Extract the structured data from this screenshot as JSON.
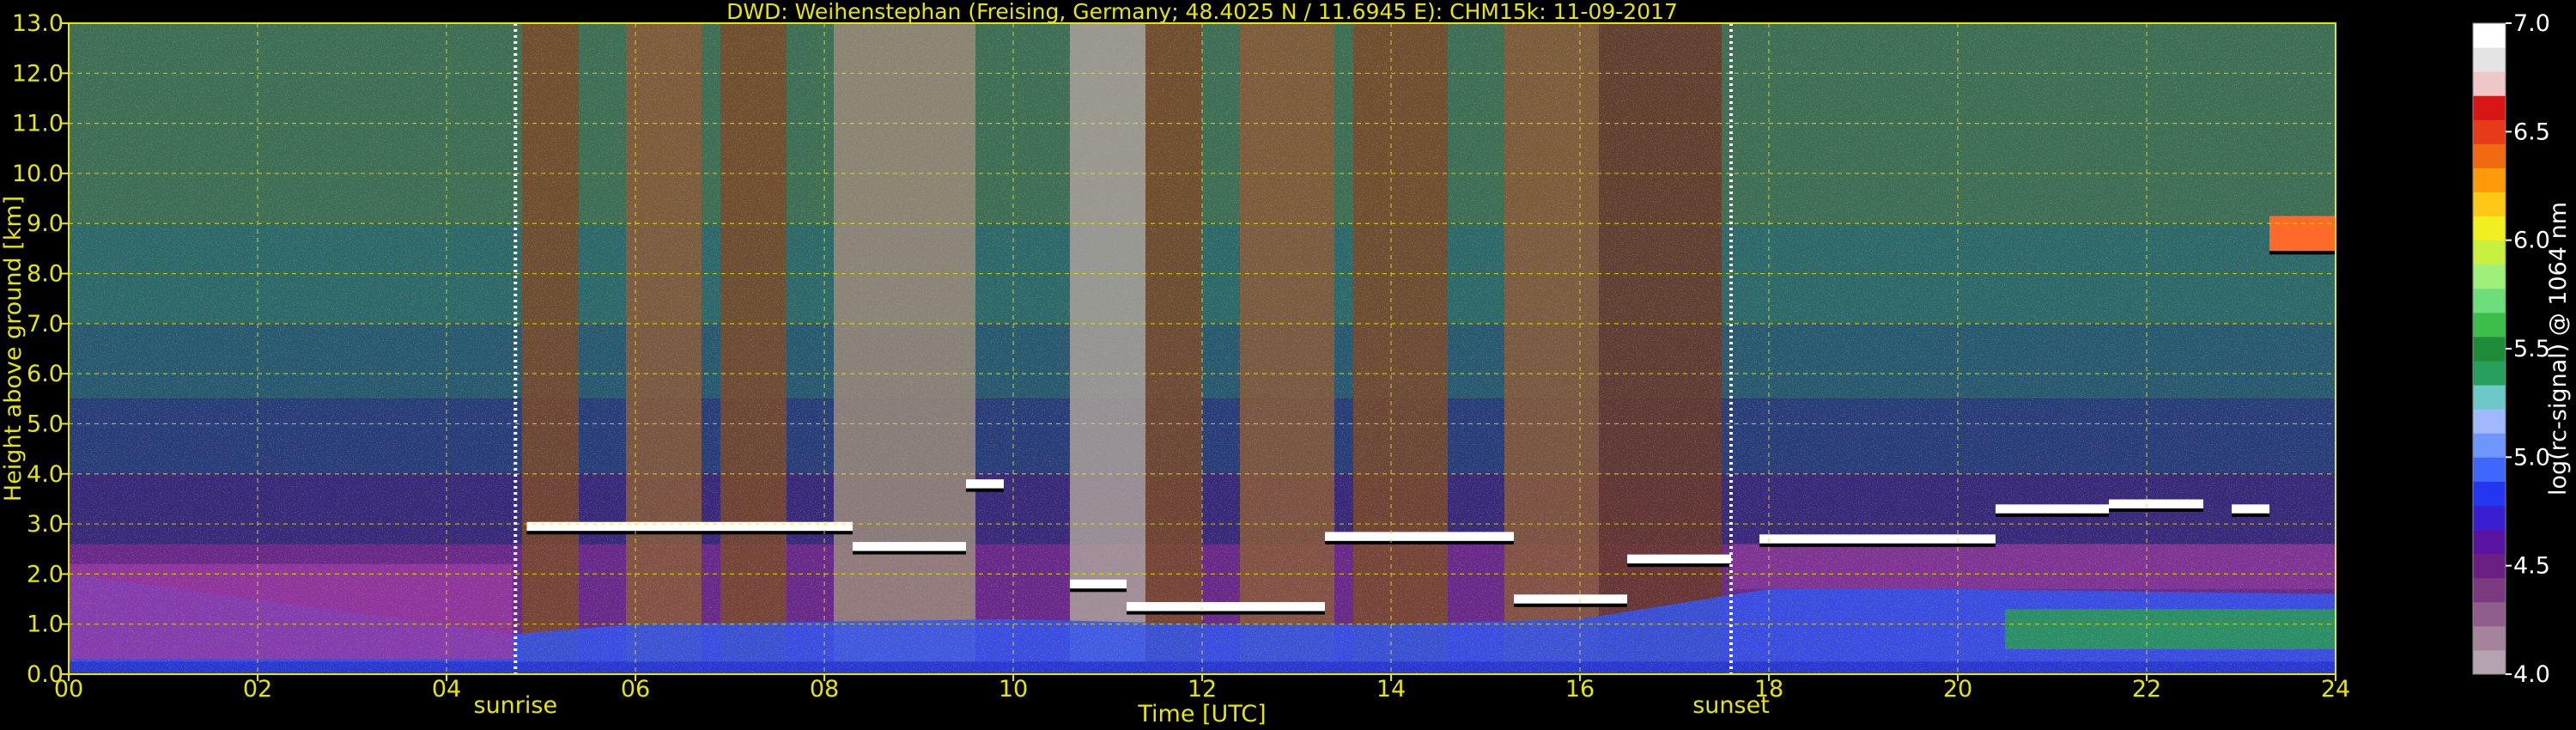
{
  "chart_data": {
    "type": "heatmap",
    "title": "DWD: Weihenstephan (Freising, Germany; 48.4025 N / 11.6945 E):    CHM15k: 11-09-2017",
    "xlabel": "Time [UTC]",
    "ylabel": "Height above ground [km]",
    "xlim": [
      0,
      24
    ],
    "ylim": [
      0,
      13
    ],
    "x_ticks": [
      "00",
      "02",
      "04",
      "06",
      "08",
      "10",
      "12",
      "14",
      "16",
      "18",
      "20",
      "22",
      "24"
    ],
    "x_tick_values": [
      0,
      2,
      4,
      6,
      8,
      10,
      12,
      14,
      16,
      18,
      20,
      22,
      24
    ],
    "y_ticks": [
      "0.0",
      "1.0",
      "2.0",
      "3.0",
      "4.0",
      "5.0",
      "6.0",
      "7.0",
      "8.0",
      "9.0",
      "10.0",
      "11.0",
      "12.0",
      "13.0"
    ],
    "y_tick_values": [
      0,
      1,
      2,
      3,
      4,
      5,
      6,
      7,
      8,
      9,
      10,
      11,
      12,
      13
    ],
    "grid": true,
    "events": [
      {
        "label": "sunrise",
        "time": 4.73
      },
      {
        "label": "sunset",
        "time": 17.6
      }
    ],
    "colorbar": {
      "label": "log(rc-signal) @ 1064 nm",
      "range": [
        4.0,
        7.0
      ],
      "ticks": [
        "4.0",
        "4.5",
        "5.0",
        "5.5",
        "6.0",
        "6.5",
        "7.0"
      ],
      "tick_values": [
        4.0,
        4.5,
        5.0,
        5.5,
        6.0,
        6.5,
        7.0
      ],
      "colors": [
        "#b5a4b0",
        "#a5839d",
        "#8f5e8a",
        "#7a3a80",
        "#6b1f80",
        "#5a14a0",
        "#3a1fd0",
        "#2436f0",
        "#3f66ff",
        "#6f95ff",
        "#9fb8ff",
        "#6ec8c8",
        "#26a05a",
        "#1f8c3a",
        "#3dbd4a",
        "#6ede7a",
        "#9ef07a",
        "#c8f040",
        "#f0f020",
        "#ffc814",
        "#ff9a0a",
        "#f26a10",
        "#e63a1a",
        "#d81616",
        "#eec8c8",
        "#e4e4e4",
        "#ffffff"
      ]
    },
    "cloud_layers": [
      {
        "start": 4.85,
        "end": 8.3,
        "height_km": 2.95
      },
      {
        "start": 8.3,
        "end": 9.5,
        "height_km": 2.55
      },
      {
        "start": 9.5,
        "end": 9.9,
        "height_km": 3.8
      },
      {
        "start": 10.6,
        "end": 11.2,
        "height_km": 1.8
      },
      {
        "start": 11.2,
        "end": 13.3,
        "height_km": 1.35
      },
      {
        "start": 13.3,
        "end": 15.3,
        "height_km": 2.75
      },
      {
        "start": 15.3,
        "end": 16.5,
        "height_km": 1.5
      },
      {
        "start": 16.5,
        "end": 17.6,
        "height_km": 2.3
      },
      {
        "start": 17.9,
        "end": 20.4,
        "height_km": 2.7
      },
      {
        "start": 20.4,
        "end": 21.6,
        "height_km": 3.3
      },
      {
        "start": 21.6,
        "end": 22.6,
        "height_km": 3.4
      },
      {
        "start": 22.9,
        "end": 23.3,
        "height_km": 3.3
      },
      {
        "start": 23.3,
        "end": 24.0,
        "height_km": 8.8
      }
    ],
    "boundary_layer_top_km": [
      {
        "time": 0,
        "value": 2.0
      },
      {
        "time": 4.7,
        "value": 0.8
      },
      {
        "time": 6,
        "value": 1.0
      },
      {
        "time": 10,
        "value": 1.1
      },
      {
        "time": 12,
        "value": 1.0
      },
      {
        "time": 14,
        "value": 1.0
      },
      {
        "time": 16,
        "value": 1.1
      },
      {
        "time": 18,
        "value": 1.7
      },
      {
        "time": 20,
        "value": 1.7
      },
      {
        "time": 24,
        "value": 1.6
      }
    ]
  }
}
